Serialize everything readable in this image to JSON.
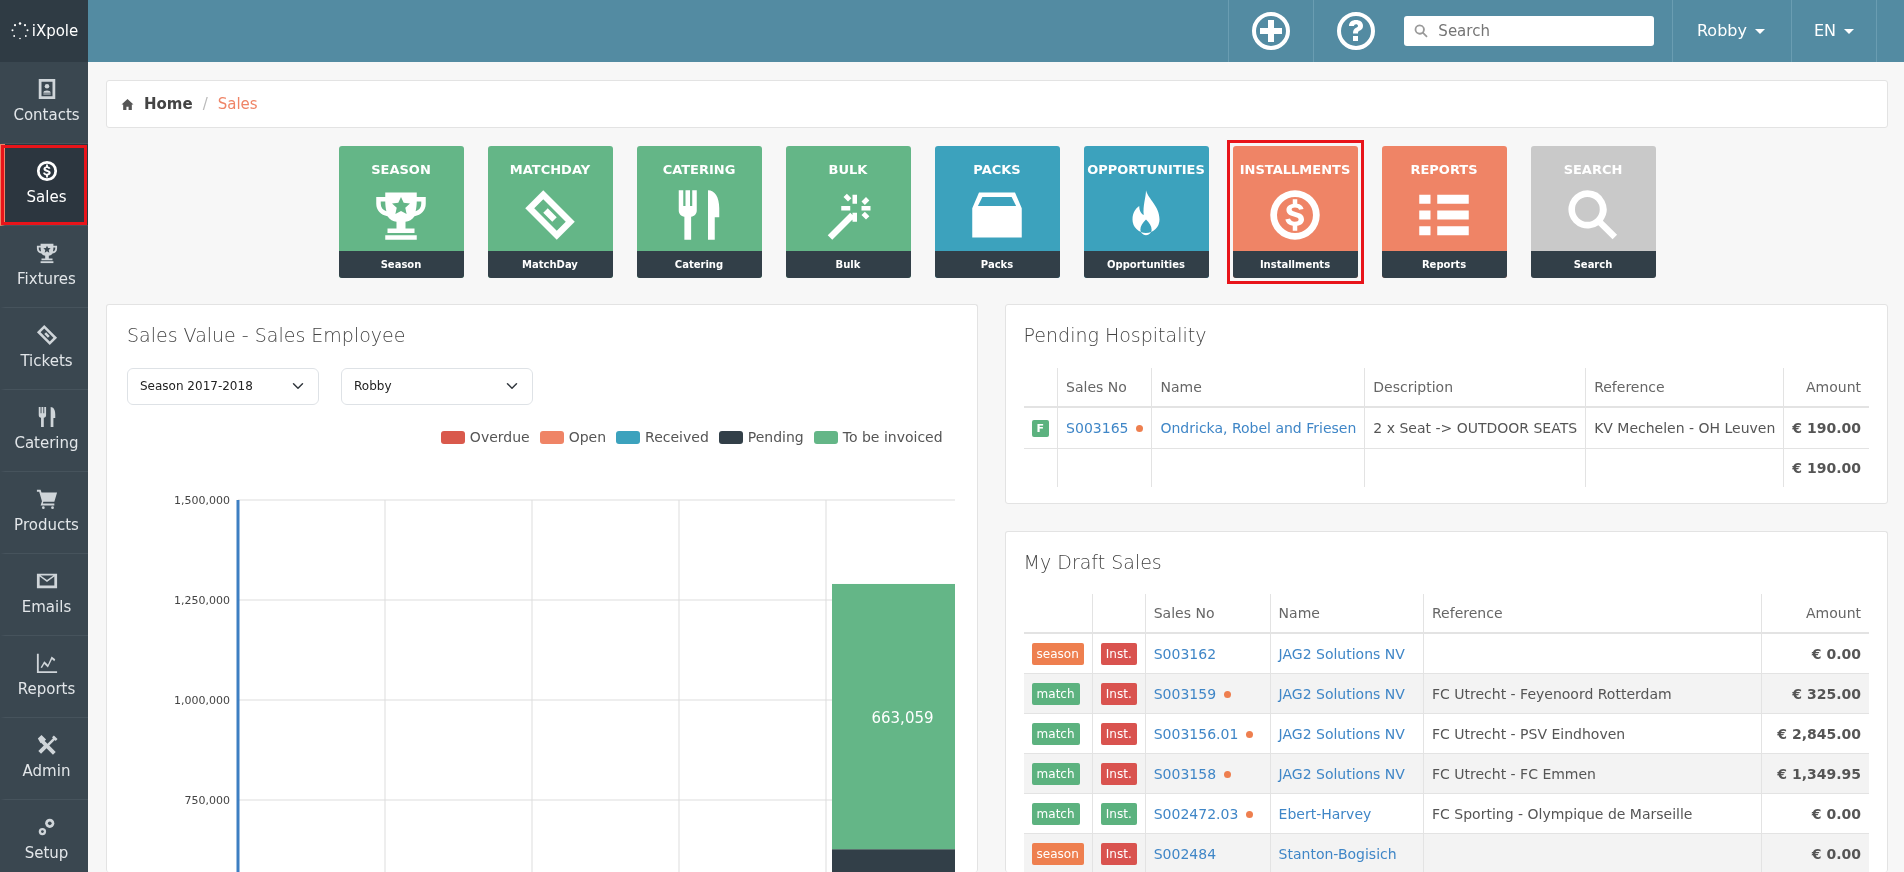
{
  "top_bar": {
    "logo_text": "iXpole",
    "search": {
      "placeholder": "Search"
    },
    "user_menu": "Robby",
    "language_menu": "EN"
  },
  "sidebar": {
    "items": [
      {
        "label": "Contacts",
        "selected": false,
        "highlighted": false
      },
      {
        "label": "Sales",
        "selected": true,
        "highlighted": true
      },
      {
        "label": "Fixtures",
        "selected": false,
        "highlighted": false
      },
      {
        "label": "Tickets",
        "selected": false,
        "highlighted": false
      },
      {
        "label": "Catering",
        "selected": false,
        "highlighted": false
      },
      {
        "label": "Products",
        "selected": false,
        "highlighted": false
      },
      {
        "label": "Emails",
        "selected": false,
        "highlighted": false
      },
      {
        "label": "Reports",
        "selected": false,
        "highlighted": false
      },
      {
        "label": "Admin",
        "selected": false,
        "highlighted": false
      },
      {
        "label": "Setup",
        "selected": false,
        "highlighted": false
      }
    ]
  },
  "breadcrumb": {
    "separator": "/",
    "items": [
      {
        "label": "Home",
        "selected": false
      },
      {
        "label": "Sales",
        "selected": true
      }
    ]
  },
  "tiles": [
    {
      "title": "SEASON",
      "caption": "Season",
      "color": "#64b687",
      "highlighted": false
    },
    {
      "title": "MATCHDAY",
      "caption": "MatchDay",
      "color": "#64b687",
      "highlighted": false
    },
    {
      "title": "CATERING",
      "caption": "Catering",
      "color": "#64b687",
      "highlighted": false
    },
    {
      "title": "BULK",
      "caption": "Bulk",
      "color": "#64b687",
      "highlighted": false
    },
    {
      "title": "PACKS",
      "caption": "Packs",
      "color": "#3ca2bd",
      "highlighted": false
    },
    {
      "title": "OPPORTUNITIES",
      "caption": "Opportunities",
      "color": "#3ca2bd",
      "highlighted": false
    },
    {
      "title": "INSTALLMENTS",
      "caption": "Installments",
      "color": "#ef8466",
      "highlighted": true
    },
    {
      "title": "REPORTS",
      "caption": "Reports",
      "color": "#ef8466",
      "highlighted": false
    },
    {
      "title": "SEARCH",
      "caption": "Search",
      "color": "#c9c9c9",
      "highlighted": false
    }
  ],
  "sales_value_panel": {
    "title": "Sales Value - Sales Employee",
    "season_select": "Season 2017-2018",
    "employee_select": "Robby",
    "chart_data": {
      "type": "bar",
      "stacked": true,
      "grid": true,
      "ylim": [
        0,
        1500000
      ],
      "value_labels": [
        [
          null,
          null,
          null,
          null,
          null
        ],
        [
          null,
          null,
          null,
          null,
          null
        ],
        [
          null,
          null,
          null,
          null,
          null
        ],
        [
          null,
          null,
          null,
          null,
          null
        ],
        [
          null,
          null,
          null,
          null,
          "663,059"
        ]
      ],
      "yticks": [
        {
          "value": 750000,
          "label": "750,000"
        },
        {
          "value": 1000000,
          "label": "1,000,000"
        },
        {
          "value": 1250000,
          "label": "1,250,000"
        },
        {
          "value": 1500000,
          "label": "1,500,000"
        }
      ],
      "series": [
        {
          "name": "Overdue",
          "color": "#d9594c",
          "values": [
            null,
            null,
            null,
            null,
            null
          ]
        },
        {
          "name": "Open",
          "color": "#ef8466",
          "values": [
            null,
            null,
            null,
            null,
            null
          ]
        },
        {
          "name": "Received",
          "color": "#3ca2bd",
          "values": [
            null,
            null,
            null,
            null,
            null
          ]
        },
        {
          "name": "Pending",
          "color": "#323f48",
          "values": [
            null,
            null,
            null,
            null,
            627000
          ]
        },
        {
          "name": "To be invoiced",
          "color": "#64b687",
          "values": [
            null,
            null,
            null,
            null,
            663059
          ]
        }
      ]
    }
  },
  "pending_hospitality": {
    "title": "Pending Hospitality",
    "columns": [
      "Sales No",
      "Name",
      "Description",
      "Reference",
      "Amount"
    ],
    "rows": [
      {
        "badge": "F",
        "sales_no": "S003165",
        "flagged": true,
        "name": "Ondricka, Robel and Friesen",
        "description": "2 x Seat -> OUTDOOR SEATS",
        "reference": "KV Mechelen - OH Leuven",
        "amount": "€ 190.00"
      }
    ],
    "total": "€ 190.00"
  },
  "draft_sales": {
    "title": "My Draft Sales",
    "columns": [
      "Sales No",
      "Name",
      "Reference",
      "Amount"
    ],
    "rows": [
      {
        "type_tag": {
          "text": "season",
          "color": "#ee7f4f"
        },
        "inst_tag": {
          "text": "Inst.",
          "color": "#d9534f"
        },
        "sales_no": "S003162",
        "flagged": false,
        "name": "JAG2 Solutions NV",
        "reference": "",
        "amount": "€ 0.00"
      },
      {
        "type_tag": {
          "text": "match",
          "color": "#5cb27f"
        },
        "inst_tag": {
          "text": "Inst.",
          "color": "#d9534f"
        },
        "sales_no": "S003159",
        "flagged": true,
        "name": "JAG2 Solutions NV",
        "reference": "FC Utrecht - Feyenoord Rotterdam",
        "amount": "€ 325.00"
      },
      {
        "type_tag": {
          "text": "match",
          "color": "#5cb27f"
        },
        "inst_tag": {
          "text": "Inst.",
          "color": "#d9534f"
        },
        "sales_no": "S003156.01",
        "flagged": true,
        "name": "JAG2 Solutions NV",
        "reference": "FC Utrecht - PSV Eindhoven",
        "amount": "€ 2,845.00"
      },
      {
        "type_tag": {
          "text": "match",
          "color": "#5cb27f"
        },
        "inst_tag": {
          "text": "Inst.",
          "color": "#d9534f"
        },
        "sales_no": "S003158",
        "flagged": true,
        "name": "JAG2 Solutions NV",
        "reference": "FC Utrecht - FC Emmen",
        "amount": "€ 1,349.95"
      },
      {
        "type_tag": {
          "text": "match",
          "color": "#5cb27f"
        },
        "inst_tag": {
          "text": "Inst.",
          "color": "#5cb27f"
        },
        "sales_no": "S002472.03",
        "flagged": true,
        "name": "Ebert-Harvey",
        "reference": "FC Sporting - Olympique de Marseille",
        "amount": "€ 0.00"
      },
      {
        "type_tag": {
          "text": "season",
          "color": "#ee7f4f"
        },
        "inst_tag": {
          "text": "Inst.",
          "color": "#d9534f"
        },
        "sales_no": "S002484",
        "flagged": false,
        "name": "Stanton-Bogisich",
        "reference": "",
        "amount": "€ 0.00"
      }
    ]
  }
}
